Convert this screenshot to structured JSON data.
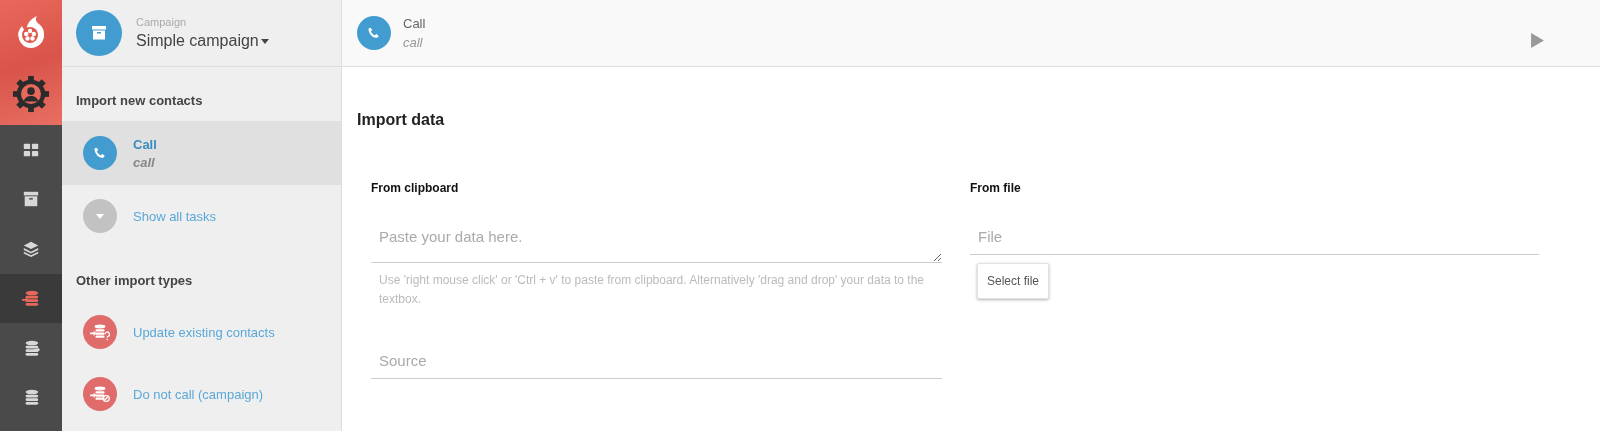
{
  "rail": {
    "items": [
      {
        "selected": false
      },
      {
        "selected": false
      },
      {
        "selected": false
      },
      {
        "selected": true
      },
      {
        "selected": false
      },
      {
        "selected": false
      }
    ]
  },
  "sidebar": {
    "campaign_label": "Campaign",
    "campaign_name": "Simple campaign",
    "sections": [
      {
        "title": "Import new contacts",
        "items": [
          {
            "kind": "task",
            "title": "Call",
            "subtitle": "call",
            "selected": true
          },
          {
            "kind": "more",
            "title": "Show all tasks",
            "selected": false
          }
        ]
      },
      {
        "title": "Other import types",
        "items": [
          {
            "kind": "update",
            "title": "Update existing contacts",
            "selected": false
          },
          {
            "kind": "dnc",
            "title": "Do not call (campaign)",
            "selected": false
          }
        ]
      }
    ]
  },
  "header": {
    "title": "Call",
    "subtitle": "call"
  },
  "main": {
    "title": "Import data",
    "clipboard": {
      "title": "From clipboard",
      "placeholder": "Paste your data here.",
      "help": "Use 'right mouse click' or 'Ctrl + v' to paste from clipboard. Alternatively 'drag and drop' your data to the textbox.",
      "source_placeholder": "Source"
    },
    "file": {
      "title": "From file",
      "placeholder": "File",
      "button": "Select file"
    }
  }
}
